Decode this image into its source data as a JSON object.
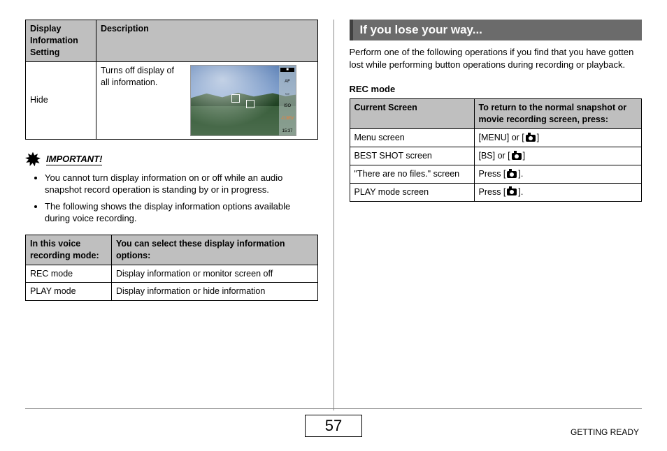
{
  "left": {
    "table1": {
      "headers": [
        "Display Information Setting",
        "Description"
      ],
      "row": {
        "setting": "Hide",
        "desc": "Turns off display of all information."
      },
      "camera_osd": {
        "top_badge": "■",
        "af": "AF",
        "mid1": "▭",
        "iso_label": "ISO",
        "ev": "-0.3EV",
        "time": "15:37"
      }
    },
    "important_label": "IMPORTANT!",
    "bullets": [
      "You cannot turn display information on or off while an audio snapshot record operation is standing by or in progress.",
      "The following shows the display information options available during voice recording."
    ],
    "table2": {
      "headers": [
        "In this voice recording mode:",
        "You can select these display information options:"
      ],
      "rows": [
        [
          "REC mode",
          "Display information or monitor screen off"
        ],
        [
          "PLAY mode",
          "Display information or hide information"
        ]
      ]
    }
  },
  "right": {
    "section_title": "If you lose your way...",
    "intro": "Perform one of the following operations if you find that you have gotten lost while performing button operations during recording or playback.",
    "subhead": "REC mode",
    "table3": {
      "headers": [
        "Current Screen",
        "To return to the normal snapshot or movie recording screen, press:"
      ],
      "rows": [
        {
          "screen": "Menu screen",
          "action_prefix": "[MENU] or [",
          "action_suffix": "]"
        },
        {
          "screen": "BEST SHOT screen",
          "action_prefix": "[BS] or [",
          "action_suffix": "]"
        },
        {
          "screen": "\"There are no files.\" screen",
          "action_prefix": "Press [",
          "action_suffix": "]."
        },
        {
          "screen": "PLAY mode screen",
          "action_prefix": "Press [",
          "action_suffix": "]."
        }
      ]
    }
  },
  "footer": {
    "page_number": "57",
    "section": "GETTING READY"
  }
}
